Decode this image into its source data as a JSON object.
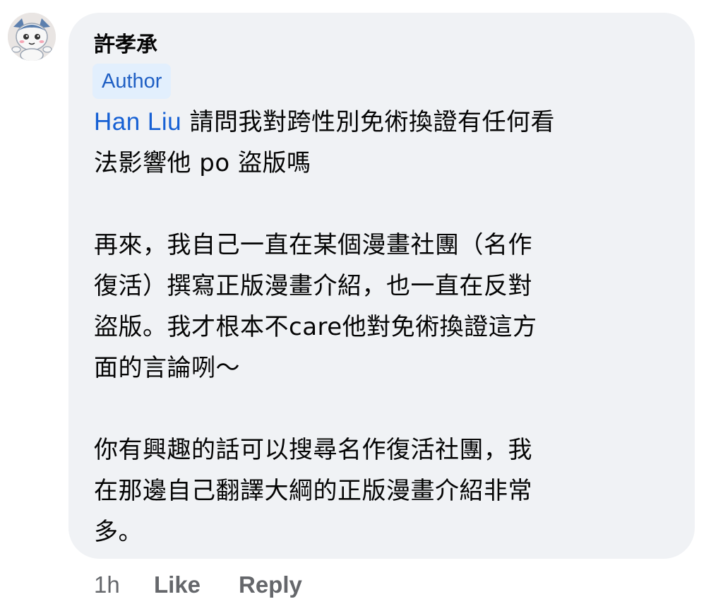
{
  "comment": {
    "author": {
      "name": "許孝承",
      "badge": "Author",
      "avatar_icon": "cartoon-avatar-icon"
    },
    "mention": "Han Liu",
    "paragraphs": [
      [
        "請問我對跨性別免術換證有任何看",
        "法影響他 po 盜版嗎"
      ],
      [
        "再來，我自己一直在某個漫畫社團（名作",
        "復活）撰寫正版漫畫介紹，也一直在反對",
        "盜版。我才根本不care他對免術換證這方",
        "面的言論咧～"
      ],
      [
        "你有興趣的話可以搜尋名作復活社團，我",
        "在那邊自己翻譯大綱的正版漫畫介紹非常",
        "多。"
      ]
    ],
    "timestamp": "1h",
    "like_label": "Like",
    "reply_label": "Reply"
  },
  "colors": {
    "bubble": "#f0f2f5",
    "mention": "#1660d4",
    "badge_bg": "#e2effd",
    "badge_text": "#1f5fc4",
    "meta_text": "#65676b"
  }
}
